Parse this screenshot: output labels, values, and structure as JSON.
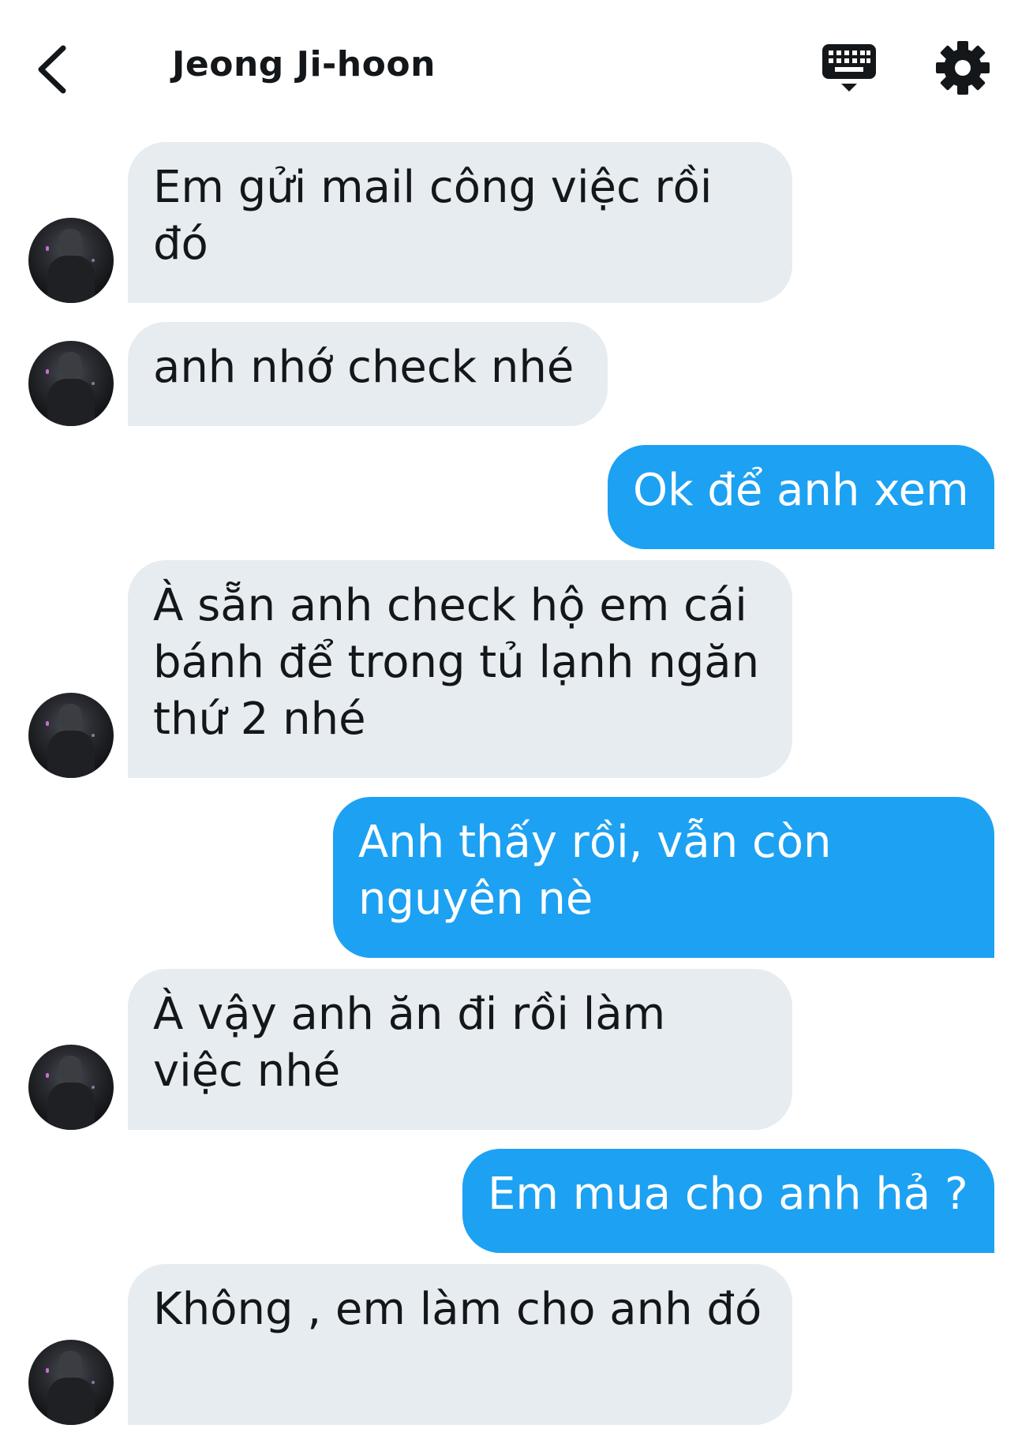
{
  "header": {
    "title": "Jeong Ji-hoon",
    "back_icon": "chevron-left-icon",
    "keyboard_icon": "keyboard-icon",
    "settings_icon": "gear-icon"
  },
  "colors": {
    "incoming_bubble": "#e6ecf0",
    "outgoing_bubble": "#1da1f2",
    "text_dark": "#14171a",
    "text_light": "#ffffff"
  },
  "messages": [
    {
      "direction": "incoming",
      "text": "Em gửi mail công việc rồi đó"
    },
    {
      "direction": "incoming",
      "text": "anh nhớ check nhé"
    },
    {
      "direction": "outgoing",
      "text": "Ok để anh xem"
    },
    {
      "direction": "incoming",
      "text": "À sẵn anh check hộ em cái bánh để trong tủ lạnh ngăn thứ 2 nhé"
    },
    {
      "direction": "outgoing",
      "text": "Anh thấy rồi, vẫn còn nguyên nè"
    },
    {
      "direction": "incoming",
      "text": "À vậy anh ăn đi rồi làm việc nhé"
    },
    {
      "direction": "outgoing",
      "text": "Em mua cho anh hả ?"
    },
    {
      "direction": "incoming",
      "text": "Không , em làm cho anh đó"
    }
  ]
}
